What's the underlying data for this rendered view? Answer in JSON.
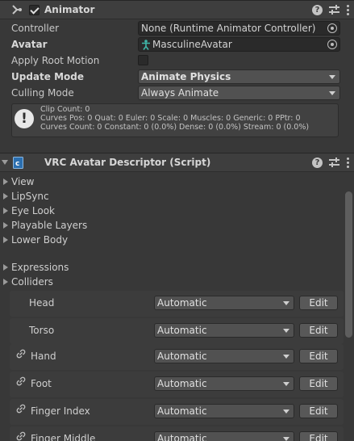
{
  "animator": {
    "title": "Animator",
    "enabled": true,
    "controller": {
      "label": "Controller",
      "value": "None (Runtime Animator Controller)"
    },
    "avatar": {
      "label": "Avatar",
      "value": "MasculineAvatar"
    },
    "apply_root_motion": {
      "label": "Apply Root Motion",
      "checked": false
    },
    "update_mode": {
      "label": "Update Mode",
      "value": "Animate Physics"
    },
    "culling_mode": {
      "label": "Culling Mode",
      "value": "Always Animate"
    },
    "info": {
      "line1": "Clip Count: 0",
      "line2": "Curves Pos: 0 Quat: 0 Euler: 0 Scale: 0 Muscles: 0 Generic: 0 PPtr: 0",
      "line3": "Curves Count: 0 Constant: 0 (0.0%) Dense: 0 (0.0%) Stream: 0 (0.0%)"
    }
  },
  "descriptor": {
    "title": "VRC Avatar Descriptor (Script)",
    "foldouts": [
      "View",
      "LipSync",
      "Eye Look",
      "Playable Layers",
      "Lower Body"
    ],
    "expressions": "Expressions",
    "colliders_label": "Colliders",
    "colliders": [
      {
        "name": "Head",
        "mode": "Automatic",
        "edit": "Edit",
        "linked": false
      },
      {
        "name": "Torso",
        "mode": "Automatic",
        "edit": "Edit",
        "linked": false
      },
      {
        "name": "Hand",
        "mode": "Automatic",
        "edit": "Edit",
        "linked": true
      },
      {
        "name": "Foot",
        "mode": "Automatic",
        "edit": "Edit",
        "linked": true
      },
      {
        "name": "Finger Index",
        "mode": "Automatic",
        "edit": "Edit",
        "linked": true
      },
      {
        "name": "Finger Middle",
        "mode": "Automatic",
        "edit": "Edit",
        "linked": true
      }
    ]
  }
}
